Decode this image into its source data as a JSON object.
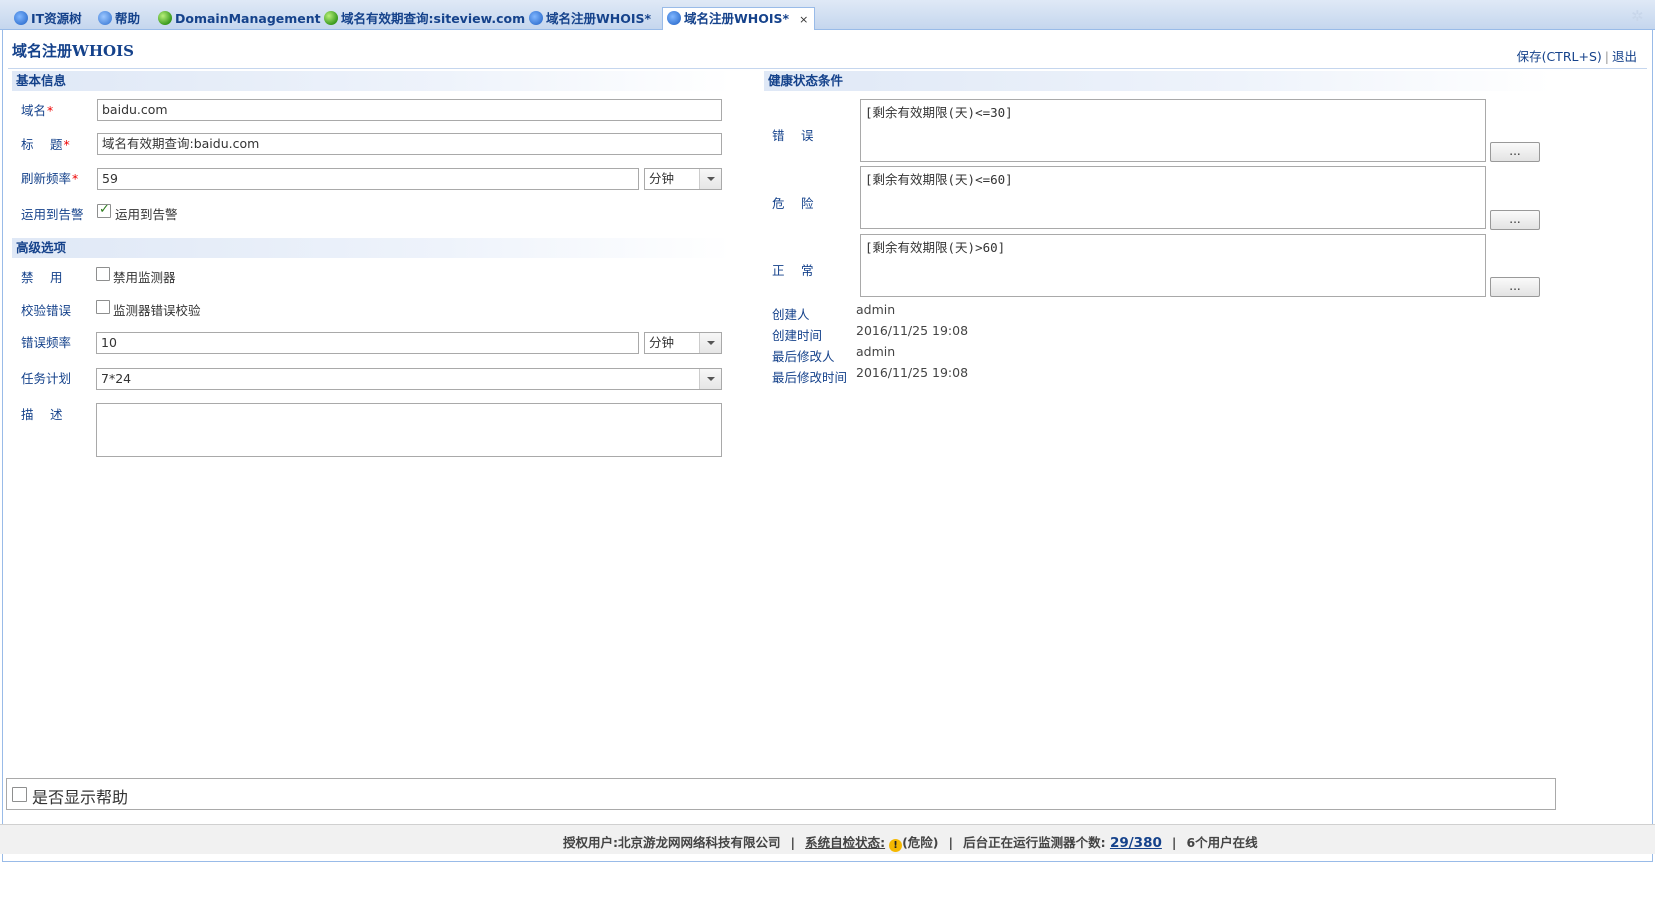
{
  "tabs": [
    {
      "label": "IT资源树",
      "icon": "logo-icon"
    },
    {
      "label": "帮助",
      "icon": "help-icon"
    },
    {
      "label": "DomainManagement",
      "icon": "globe-icon"
    },
    {
      "label": "域名有效期查询:siteview.com",
      "icon": "globe-icon"
    },
    {
      "label": "域名注册WHOIS*",
      "icon": "logo-icon"
    },
    {
      "label": "域名注册WHOIS*",
      "icon": "logo-icon",
      "active": true,
      "close": "×"
    }
  ],
  "page": {
    "title": "域名注册WHOIS",
    "save_label": "保存(CTRL+S)",
    "separator": "|",
    "exit_label": "退出"
  },
  "basic": {
    "section_title": "基本信息",
    "domain_label": "域名",
    "domain_value": "baidu.com",
    "title_label": "标　 题",
    "title_value": "域名有效期查询:baidu.com",
    "freq_label": "刷新频率",
    "freq_value": "59",
    "freq_unit": "分钟",
    "alarm_label": "运用到告警",
    "alarm_checkbox_text": "运用到告警",
    "alarm_checked": true,
    "required_mark": "*"
  },
  "advanced": {
    "section_title": "高级选项",
    "disable_label": "禁　 用",
    "disable_checkbox_text": "禁用监测器",
    "verify_label": "校验错误",
    "verify_checkbox_text": "监测器错误校验",
    "err_freq_label": "错误频率",
    "err_freq_value": "10",
    "err_freq_unit": "分钟",
    "schedule_label": "任务计划",
    "schedule_value": "7*24",
    "desc_label": "描　 述",
    "desc_value": ""
  },
  "health": {
    "section_title": "健康状态条件",
    "error_label": "错　 误",
    "error_value": "[剩余有效期限(天)<=30]",
    "warning_label": "危　 险",
    "warning_value": "[剩余有效期限(天)<=60]",
    "normal_label": "正　 常",
    "normal_value": "[剩余有效期限(天)>60]",
    "button_label": "..."
  },
  "meta": {
    "creator_label": "创建人",
    "creator_value": "admin",
    "created_label": "创建时间",
    "created_value": "2016/11/25 19:08",
    "modifier_label": "最后修改人",
    "modifier_value": "admin",
    "modified_label": "最后修改时间",
    "modified_value": "2016/11/25 19:08"
  },
  "help_toggle": "是否显示帮助",
  "status": {
    "licensed_user": "授权用户:北京游龙网网络科技有限公司",
    "self_check_label": "系统自检状态:",
    "warn_glyph": "!",
    "self_check_state": "(危险)",
    "running_label": "后台正在运行监测器个数:",
    "running_count": "29/380",
    "online_users": "6个用户在线",
    "separator": "|"
  }
}
